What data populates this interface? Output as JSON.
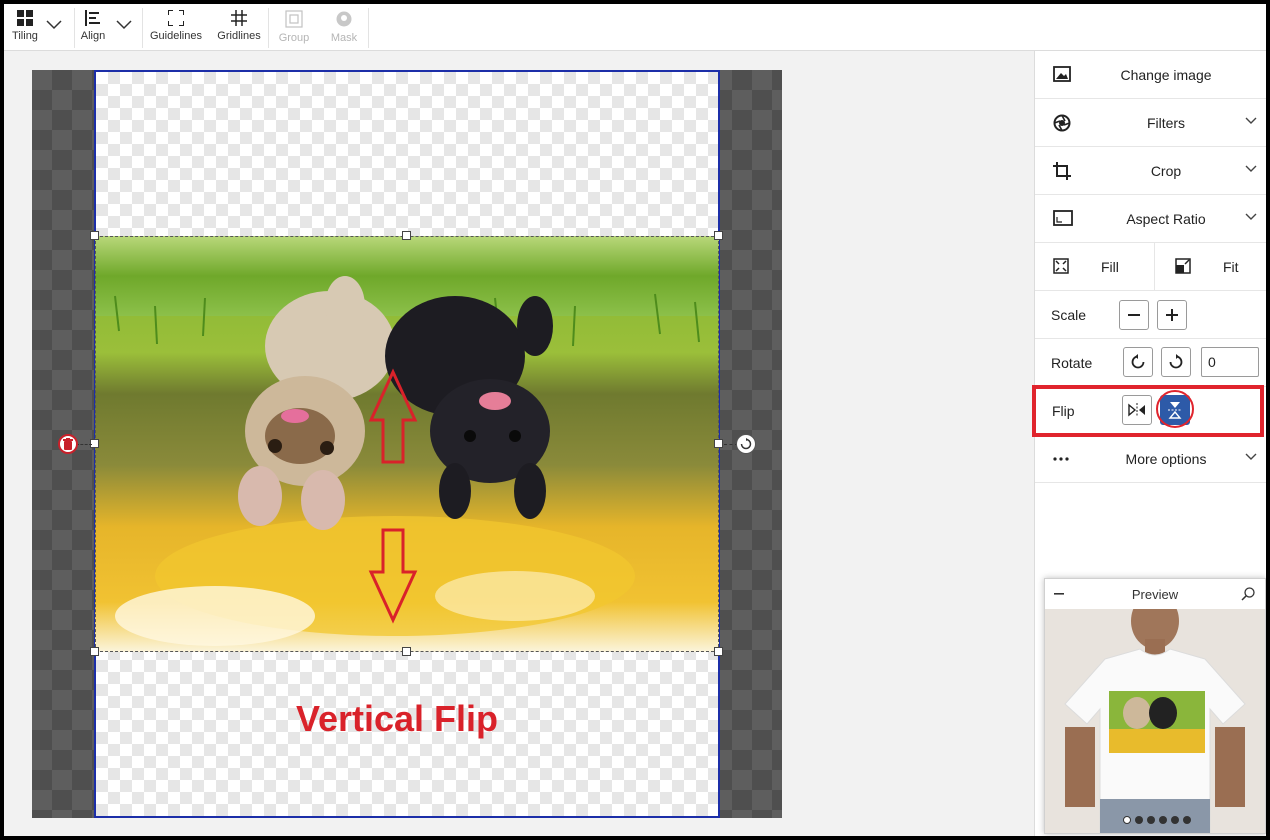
{
  "toolbar": {
    "tiling": "Tiling",
    "align": "Align",
    "guidelines": "Guidelines",
    "gridlines": "Gridlines",
    "group": "Group",
    "mask": "Mask"
  },
  "canvas": {
    "overlay_text": "Vertical Flip",
    "flip_state": "vertical"
  },
  "panel": {
    "change_image": "Change image",
    "filters": "Filters",
    "crop": "Crop",
    "aspect_ratio": "Aspect Ratio",
    "fill": "Fill",
    "fit": "Fit",
    "scale": "Scale",
    "rotate": "Rotate",
    "rotate_value": "0",
    "flip": "Flip",
    "more_options": "More options"
  },
  "preview": {
    "title": "Preview",
    "pages": 6,
    "active_page": 1
  },
  "colors": {
    "accent_blue": "#2d5aa8",
    "highlight_red": "#e0242d",
    "print_border": "#1c2ea8",
    "label_red": "#d9222a"
  }
}
